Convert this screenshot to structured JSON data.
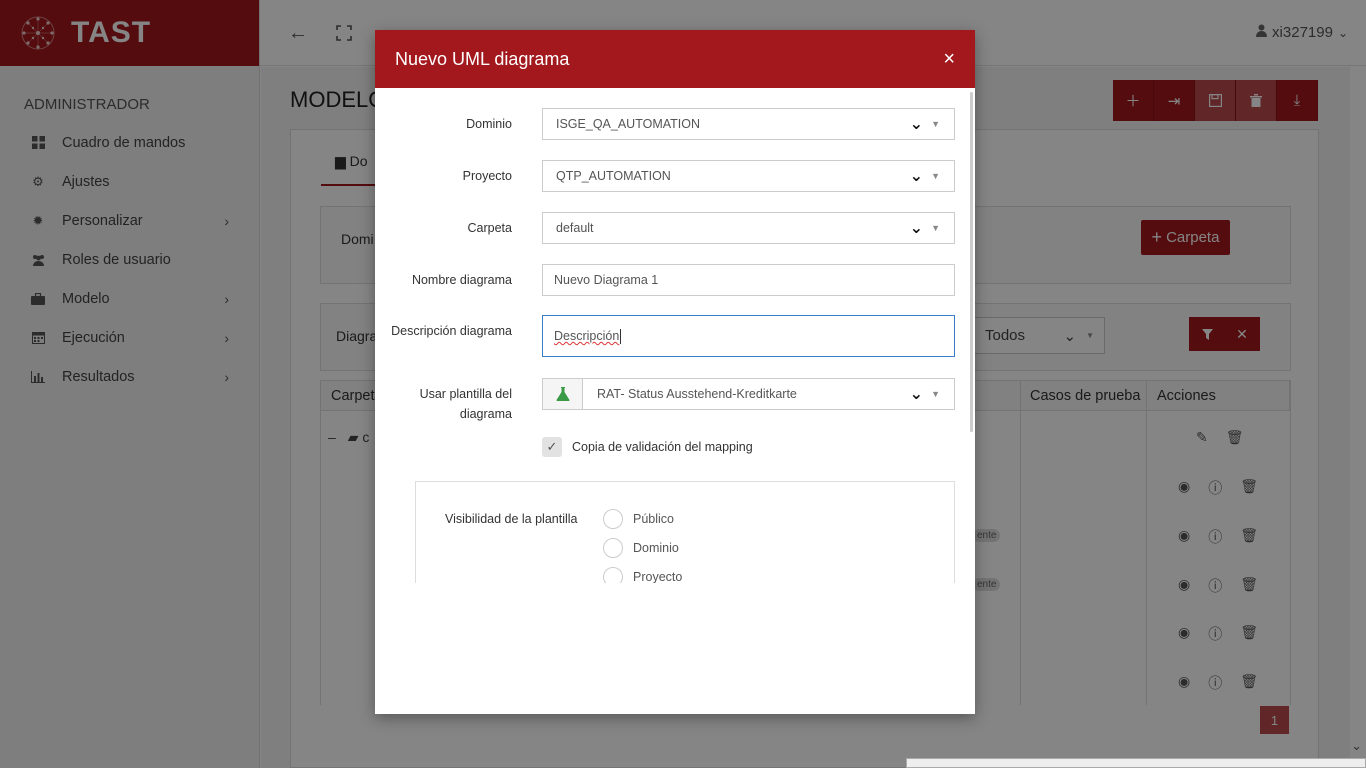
{
  "brand": {
    "name": "TAST"
  },
  "sidebar": {
    "section": "ADMINISTRADOR",
    "items": [
      {
        "label": "Cuadro de mandos",
        "icon": "dashboard-icon",
        "has_children": false
      },
      {
        "label": "Ajustes",
        "icon": "gear-icon",
        "has_children": false
      },
      {
        "label": "Personalizar",
        "icon": "palette-icon",
        "has_children": true
      },
      {
        "label": "Roles de usuario",
        "icon": "users-icon",
        "has_children": false
      },
      {
        "label": "Modelo",
        "icon": "briefcase-icon",
        "has_children": true
      },
      {
        "label": "Ejecución",
        "icon": "calendar-icon",
        "has_children": true
      },
      {
        "label": "Resultados",
        "icon": "bar-chart-icon",
        "has_children": true
      }
    ]
  },
  "topbar": {
    "user": "xi327199"
  },
  "background": {
    "page_title": "MODELO",
    "tab": "Do",
    "domain_label": "Domi",
    "diagram_label": "Diagra",
    "carpeta_button": "Carpeta",
    "todos_select": "Todos",
    "table_headers": {
      "carpeta": "Carpeta",
      "casos": "Casos de prueba",
      "acciones": "Acciones"
    },
    "folder_row": "c",
    "badge_pendiente": "ente",
    "pager_page": "1"
  },
  "modal": {
    "title": "Nuevo UML diagrama",
    "close": "×",
    "fields": {
      "dominio": {
        "label": "Dominio",
        "value": "ISGE_QA_AUTOMATION"
      },
      "proyecto": {
        "label": "Proyecto",
        "value": "QTP_AUTOMATION"
      },
      "carpeta": {
        "label": "Carpeta",
        "value": "default"
      },
      "nombre": {
        "label": "Nombre diagrama",
        "value": "Nuevo Diagrama 1"
      },
      "descripcion": {
        "label": "Descripción diagrama",
        "value": "Descripción"
      },
      "plantilla": {
        "label_line1": "Usar plantilla del",
        "label_line2": "diagrama",
        "value": "RAT- Status Ausstehend-Kreditkarte"
      }
    },
    "copy_mapping": {
      "label": "Copia de validación del mapping",
      "checked": true
    },
    "visibility": {
      "label": "Visibilidad de la plantilla",
      "options": [
        "Público",
        "Dominio",
        "Proyecto"
      ]
    }
  },
  "colors": {
    "brand": "#a2181d",
    "focus": "#3a7fc6",
    "template_icon": "#3a9a46"
  }
}
